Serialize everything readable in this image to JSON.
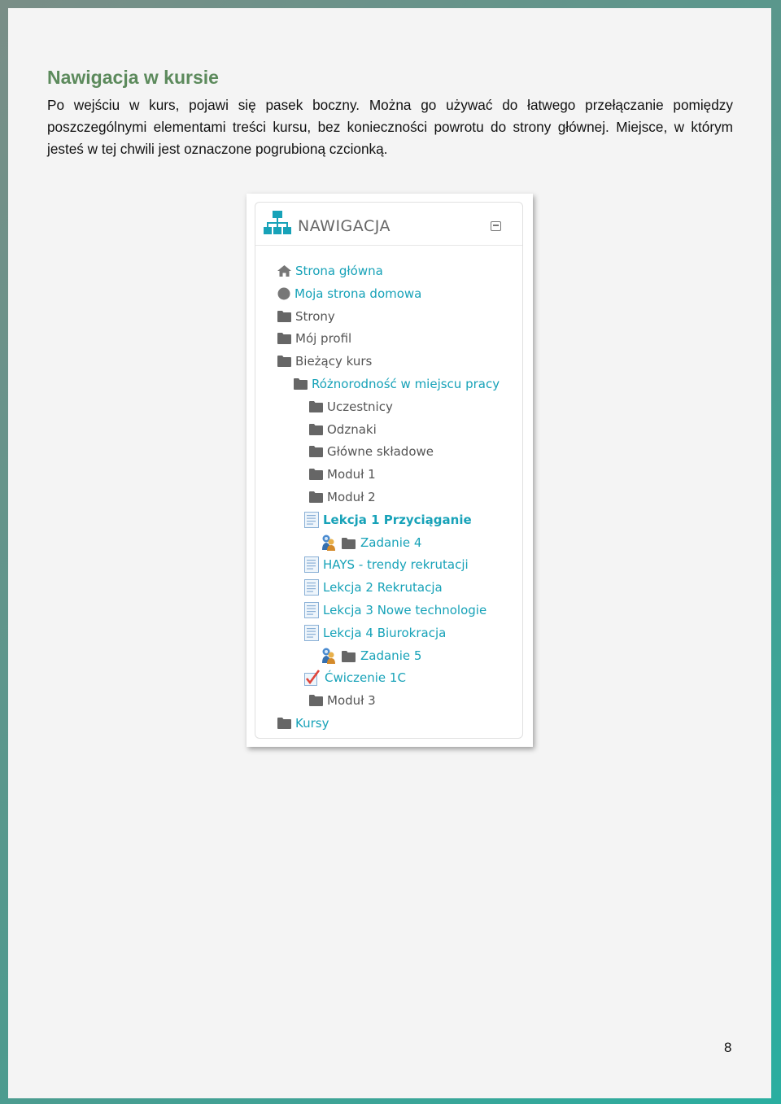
{
  "heading": "Nawigacja w kursie",
  "intro": "Po wejściu w kurs, pojawi się pasek boczny. Można go używać do łatwego przełączanie pomiędzy poszczególnymi elementami treści kursu, bez konieczności powrotu do strony głównej. Miejsce, w którym jesteś w tej chwili jest oznaczone pogrubioną czcionką.",
  "page_number": "8",
  "navigation_block": {
    "title": "NAWIGACJA",
    "items": [
      {
        "label": "Strona główna",
        "icon": "home-icon",
        "color": "teal",
        "level": 0
      },
      {
        "label": "Moja strona domowa",
        "icon": "circle-icon",
        "color": "teal",
        "level": 0
      },
      {
        "label": "Strony",
        "icon": "folder-icon",
        "color": "gray",
        "level": 0
      },
      {
        "label": "Mój profil",
        "icon": "folder-icon",
        "color": "gray",
        "level": 0
      },
      {
        "label": "Bieżący kurs",
        "icon": "folder-icon",
        "color": "gray",
        "level": 0
      },
      {
        "label": "Różnorodność w miejscu pracy",
        "icon": "folder-icon",
        "color": "teal",
        "level": 1
      },
      {
        "label": "Uczestnicy",
        "icon": "folder-icon",
        "color": "gray",
        "level": 2
      },
      {
        "label": "Odznaki",
        "icon": "folder-icon",
        "color": "gray",
        "level": 2
      },
      {
        "label": "Główne składowe",
        "icon": "folder-icon",
        "color": "gray",
        "level": 2
      },
      {
        "label": "Moduł 1",
        "icon": "folder-icon",
        "color": "gray",
        "level": 2
      },
      {
        "label": "Moduł 2",
        "icon": "folder-icon",
        "color": "gray",
        "level": 2
      },
      {
        "label": "Lekcja 1 Przyciąganie",
        "icon": "page-icon",
        "color": "teal",
        "bold": true,
        "level": 3
      },
      {
        "label": "Zadanie 4",
        "icon": "assignment-folder-icon",
        "color": "teal",
        "level": 4
      },
      {
        "label": "HAYS - trendy rekrutacji",
        "icon": "page-icon",
        "color": "teal",
        "level": 3
      },
      {
        "label": "Lekcja 2 Rekrutacja",
        "icon": "page-icon",
        "color": "teal",
        "level": 3
      },
      {
        "label": "Lekcja 3 Nowe technologie",
        "icon": "page-icon",
        "color": "teal",
        "level": 3
      },
      {
        "label": "Lekcja 4 Biurokracja",
        "icon": "page-icon",
        "color": "teal",
        "level": 3
      },
      {
        "label": "Zadanie 5",
        "icon": "assignment-folder-icon",
        "color": "teal",
        "level": 4
      },
      {
        "label": "Ćwiczenie 1C",
        "icon": "checkbox-icon",
        "color": "teal",
        "level": 3
      },
      {
        "label": "Moduł 3",
        "icon": "folder-icon",
        "color": "gray",
        "level": 2
      },
      {
        "label": "Kursy",
        "icon": "folder-icon",
        "color": "teal",
        "level": 0
      }
    ]
  },
  "colors": {
    "teal": "#17a2b8",
    "gray": "#555555",
    "heading": "#5c8a5c"
  }
}
